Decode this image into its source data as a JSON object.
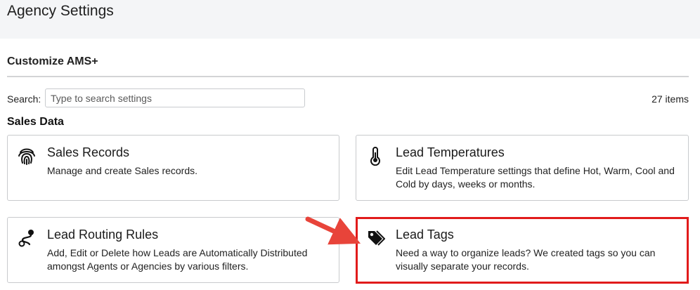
{
  "header": {
    "title": "Agency Settings"
  },
  "section": {
    "title": "Customize AMS+"
  },
  "search": {
    "label": "Search:",
    "placeholder": "Type to search settings",
    "value": ""
  },
  "items_count": "27 items",
  "groups": [
    {
      "title": "Sales Data",
      "cards": [
        {
          "title": "Sales Records",
          "description": "Manage and create Sales records.",
          "icon": "fingerprint-icon"
        },
        {
          "title": "Lead Temperatures",
          "description": "Edit Lead Temperature settings that define Hot, Warm, Cool and Cold by days, weeks or months.",
          "icon": "thermometer-icon"
        },
        {
          "title": "Lead Routing Rules",
          "description": "Add, Edit or Delete how Leads are Automatically Distributed amongst Agents or Agencies by various filters.",
          "icon": "route-icon"
        },
        {
          "title": "Lead Tags",
          "description": "Need a way to organize leads? We created tags so you can visually separate your records.",
          "icon": "tags-icon"
        }
      ]
    }
  ],
  "annotation": {
    "highlight_color": "#e11b1b",
    "arrow_color": "#e8443a"
  }
}
